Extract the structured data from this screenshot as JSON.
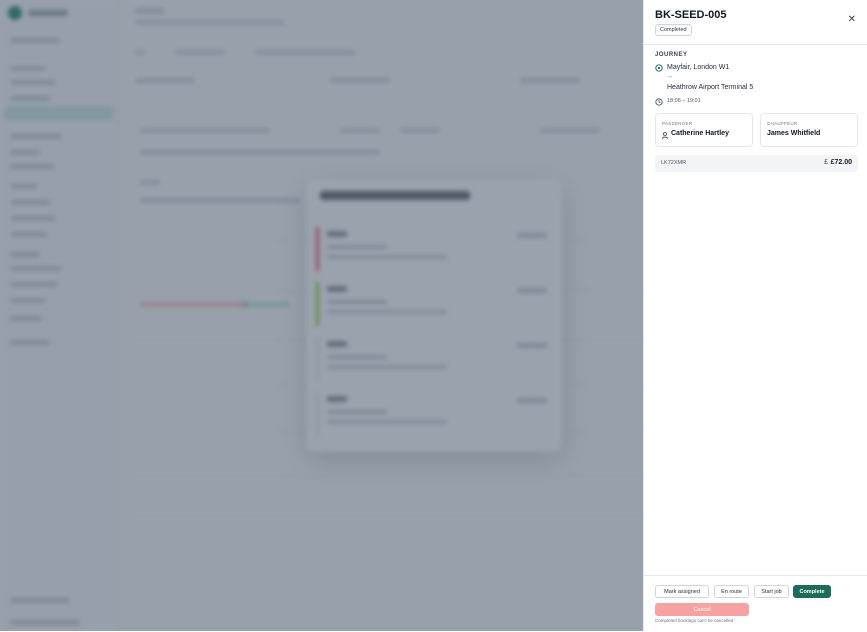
{
  "booking": {
    "id": "BK-SEED-005",
    "status": "Completed",
    "journey_label": "JOURNEY",
    "origin": "Mayfair, London W1",
    "arrow": "→",
    "destination": "Heathrow Airport Terminal 5",
    "time": "18:06 – 19:01",
    "passenger_label": "PASSENGER",
    "passenger": "Catherine Hartley",
    "chauffeur_label": "CHAUFFEUR",
    "chauffeur": "James Whitfield",
    "plate": "LK72XMR",
    "price": "£72.00"
  },
  "actions": {
    "mark_assigned": "Mark assigned",
    "en_route": "En route",
    "start_job": "Start job",
    "complete": "Complete",
    "cancel": "Cancel",
    "cancel_note": "Completed bookings can't be cancelled"
  },
  "icons": {
    "close": "close-icon",
    "pin": "map-pin-icon",
    "clock": "clock-icon",
    "person": "person-icon",
    "pound": "pound-icon"
  },
  "colors": {
    "accent": "#1e6b5c",
    "danger_disabled": "#f7a2a2",
    "overlay": "#475569"
  }
}
